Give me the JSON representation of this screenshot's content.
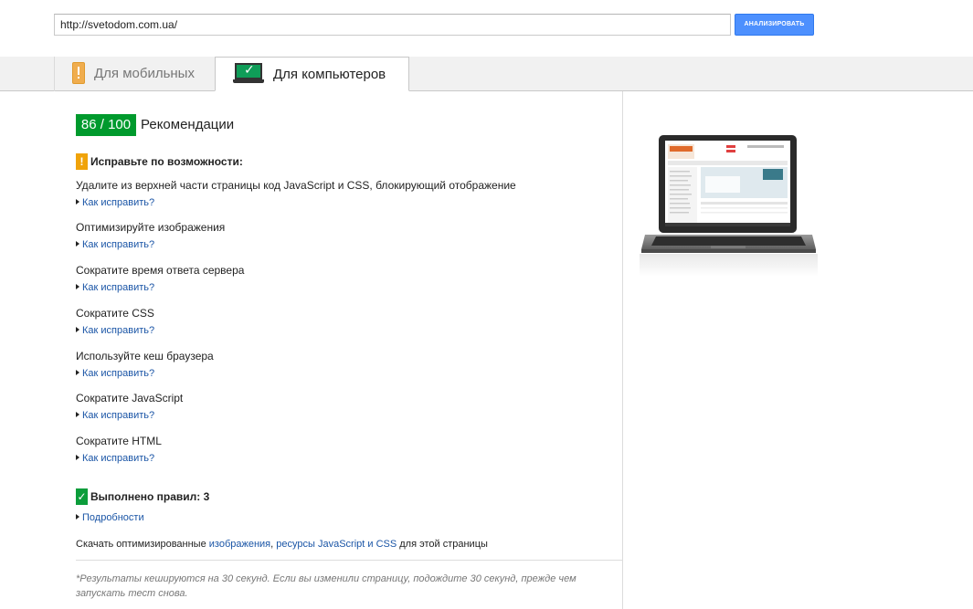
{
  "url_input": {
    "value": "http://svetodom.com.ua/"
  },
  "analyze_button": {
    "label": "АНАЛИЗИРОВАТЬ"
  },
  "tabs": [
    {
      "label": "Для мобильных",
      "icon": "mobile-warning-icon",
      "active": false
    },
    {
      "label": "Для компьютеров",
      "icon": "laptop-check-icon",
      "active": true
    }
  ],
  "score": {
    "value": "86 / 100",
    "caption": "Рекомендации",
    "color": "#009a2d"
  },
  "fix_section": {
    "title": "Исправьте по возможности:",
    "icon_text": "!",
    "rules": [
      {
        "title": "Удалите из верхней части страницы код JavaScript и CSS, блокирующий отображение",
        "link": "Как исправить?"
      },
      {
        "title": "Оптимизируйте изображения",
        "link": "Как исправить?"
      },
      {
        "title": "Сократите время ответа сервера",
        "link": "Как исправить?"
      },
      {
        "title": "Сократите CSS",
        "link": "Как исправить?"
      },
      {
        "title": "Используйте кеш браузера",
        "link": "Как исправить?"
      },
      {
        "title": "Сократите JavaScript",
        "link": "Как исправить?"
      },
      {
        "title": "Сократите HTML",
        "link": "Как исправить?"
      }
    ]
  },
  "passed_section": {
    "title": "Выполнено правил: 3",
    "icon_text": "✓",
    "details_link": "Подробности"
  },
  "download": {
    "prefix": "Скачать оптимизированные ",
    "link_images": "изображения",
    "sep": ", ",
    "link_resources": "ресурсы JavaScript и CSS",
    "suffix": " для этой страницы"
  },
  "note": "*Результаты кешируются на 30 секунд. Если вы изменили страницу, подождите 30 секунд, прежде чем запускать тест снова.",
  "colors": {
    "accent_blue": "#4d90fe",
    "link": "#1a55a6",
    "warning": "#f0a30a",
    "pass": "#0c9d3b"
  }
}
